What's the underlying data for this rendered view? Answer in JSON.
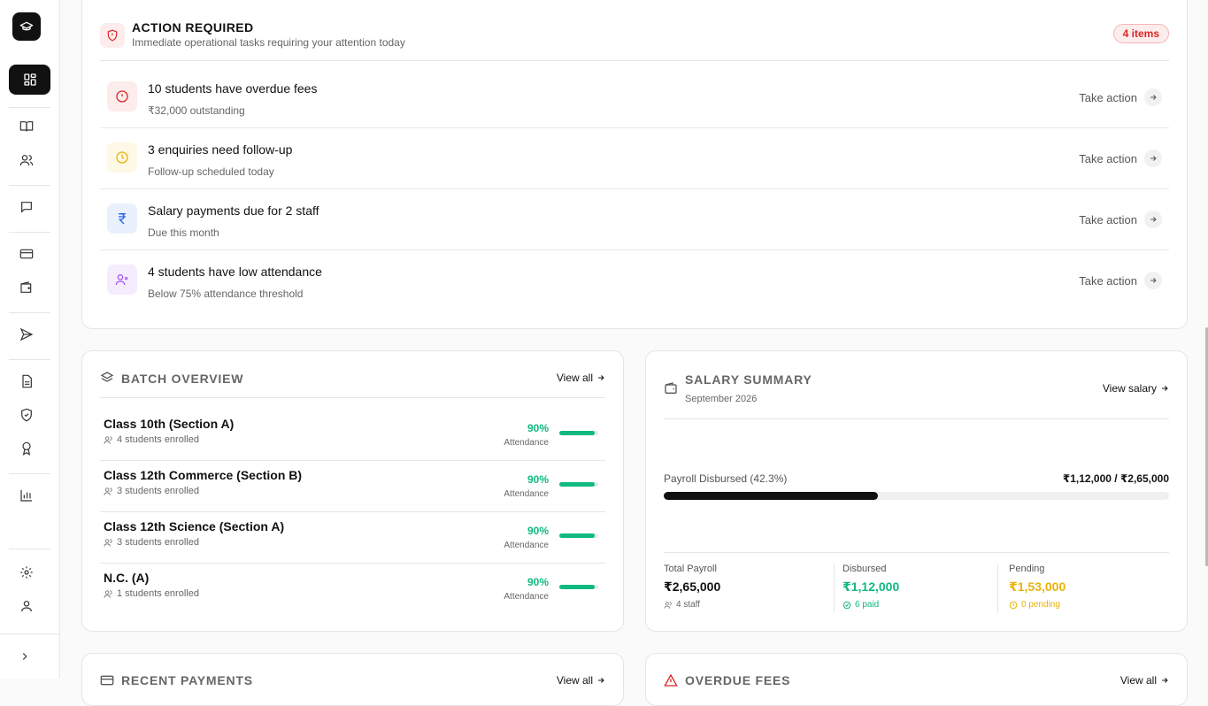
{
  "action_required": {
    "title": "ACTION REQUIRED",
    "subtitle": "Immediate operational tasks requiring your attention today",
    "badge": "4 items",
    "items": [
      {
        "title": "10 students have overdue fees",
        "subtitle": "₹32,000 outstanding",
        "action": "Take action",
        "icon": "alert-circle-icon",
        "color": "#dc2626",
        "bg": "#fdecec"
      },
      {
        "title": "3 enquiries need follow-up",
        "subtitle": "Follow-up scheduled today",
        "action": "Take action",
        "icon": "clock-icon",
        "color": "#eab308",
        "bg": "#fef9e7"
      },
      {
        "title": "Salary payments due for 2 staff",
        "subtitle": "Due this month",
        "action": "Take action",
        "icon": "rupee-icon",
        "color": "#2563eb",
        "bg": "#eaf1fd"
      },
      {
        "title": "4 students have low attendance",
        "subtitle": "Below 75% attendance threshold",
        "action": "Take action",
        "icon": "user-x-icon",
        "color": "#a855f7",
        "bg": "#f5edfd"
      }
    ]
  },
  "batch_overview": {
    "title": "BATCH OVERVIEW",
    "view_all": "View all",
    "rows": [
      {
        "name": "Class 10th (Section A)",
        "enrolled": "4 students enrolled",
        "pct": "90%",
        "att_label": "Attendance",
        "fill": 0.9
      },
      {
        "name": "Class 12th Commerce (Section B)",
        "enrolled": "3 students enrolled",
        "pct": "90%",
        "att_label": "Attendance",
        "fill": 0.9
      },
      {
        "name": "Class 12th Science (Section A)",
        "enrolled": "3 students enrolled",
        "pct": "90%",
        "att_label": "Attendance",
        "fill": 0.9
      },
      {
        "name": "N.C. (A)",
        "enrolled": "1 students enrolled",
        "pct": "90%",
        "att_label": "Attendance",
        "fill": 0.9
      }
    ]
  },
  "salary_summary": {
    "title": "SALARY SUMMARY",
    "subtitle": "September 2026",
    "view_link": "View salary",
    "progress_label": "Payroll Disbursed (42.3%)",
    "progress_value": "₹1,12,000 / ₹2,65,000",
    "progress_fraction": 0.423,
    "stats": [
      {
        "label": "Total Payroll",
        "value": "₹2,65,000",
        "foot": "4 staff",
        "color": "#111111",
        "foot_color": "#666666",
        "icon": "users-icon"
      },
      {
        "label": "Disbursed",
        "value": "₹1,12,000",
        "foot": "6 paid",
        "color": "#10b981",
        "foot_color": "#10b981",
        "icon": "check-circle-icon"
      },
      {
        "label": "Pending",
        "value": "₹1,53,000",
        "foot": "0 pending",
        "color": "#eab308",
        "foot_color": "#eab308",
        "icon": "clock-icon"
      }
    ]
  },
  "recent_payments": {
    "title": "RECENT PAYMENTS",
    "view_all": "View all"
  },
  "overdue_fees": {
    "title": "OVERDUE FEES",
    "view_all": "View all"
  },
  "sidebar": {
    "items": [
      "dashboard-icon",
      "book-icon",
      "users-icon",
      "message-icon",
      "credit-card-icon",
      "wallet-icon",
      "send-icon",
      "file-icon",
      "shield-icon",
      "award-icon",
      "bar-chart-icon",
      "settings-icon",
      "user-icon",
      "chevron-right-icon"
    ]
  }
}
